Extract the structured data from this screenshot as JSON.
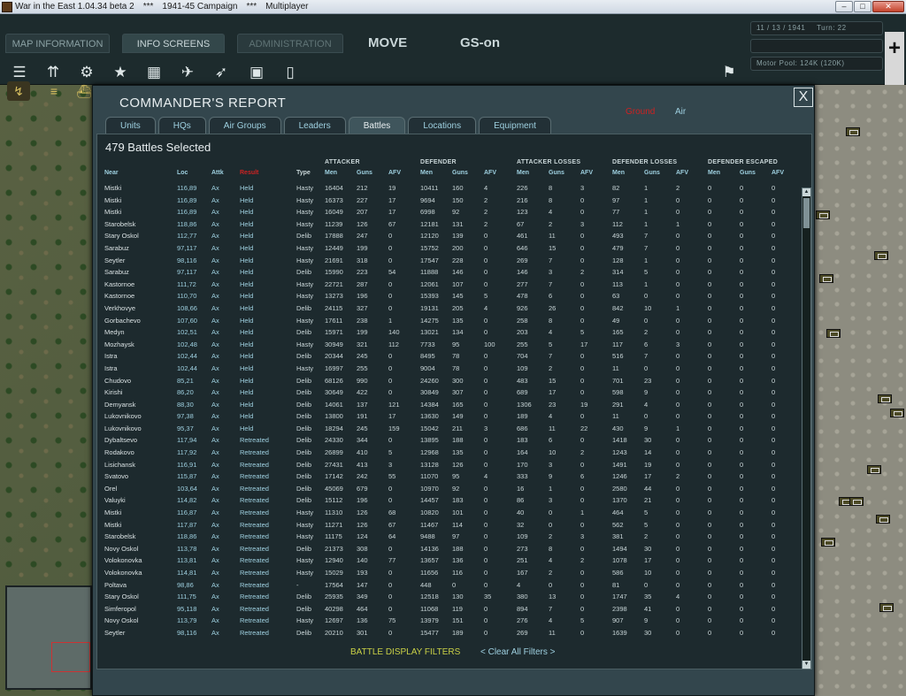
{
  "window": {
    "title": "War in the East 1.04.34 beta 2",
    "sep1": "***",
    "campaign": "1941-45 Campaign",
    "sep2": "***",
    "mode": "Multiplayer",
    "minimize": "–",
    "maximize": "□",
    "close": "✕"
  },
  "topbar": {
    "tabs": [
      "MAP INFORMATION",
      "INFO SCREENS",
      "ADMINISTRATION"
    ],
    "move": "MOVE",
    "gs": "GS-on",
    "date": "11 / 13 / 1941",
    "turn": "Turn: 22",
    "motor_pool": "Motor Pool:  124K (120K)",
    "tool_icons": [
      "stack-icon",
      "arrows-icon",
      "gear-icon",
      "star-icon",
      "factory-icon",
      "plane-icon",
      "rocket-icon",
      "clipboard-icon",
      "document-icon"
    ],
    "order_icons": [
      "path-icon",
      "rail-icon",
      "ship-icon"
    ]
  },
  "report": {
    "title": "COMMANDER'S REPORT",
    "close": "X",
    "filter_land": "Ground",
    "filter_air": "Air",
    "tabs": [
      "Units",
      "HQs",
      "Air Groups",
      "Leaders",
      "Battles",
      "Locations",
      "Equipment"
    ],
    "active_tab": "Battles",
    "count": "479 Battles Selected",
    "group_headers": {
      "attacker": "ATTACKER",
      "defender": "DEFENDER",
      "attacker_losses": "ATTACKER LOSSES",
      "defender_losses": "DEFENDER LOSSES",
      "defender_escaped": "DEFENDER ESCAPED"
    },
    "columns": {
      "near": "Near",
      "loc": "Loc",
      "attk": "Attk",
      "result": "Result",
      "type": "Type",
      "att_men": "Men",
      "att_guns": "Guns",
      "att_afv": "AFV",
      "def_men": "Men",
      "def_guns": "Guns",
      "def_afv": "AFV",
      "al_men": "Men",
      "al_guns": "Guns",
      "al_afv": "AFV",
      "dl_men": "Men",
      "dl_guns": "Guns",
      "dl_afv": "AFV",
      "de_men": "Men",
      "de_guns": "Guns",
      "de_afv": "AFV"
    },
    "rows": [
      [
        "Mistki",
        "116,89",
        "Ax",
        "Held",
        "Hasty",
        "16404",
        "212",
        "19",
        "10411",
        "160",
        "4",
        "226",
        "8",
        "3",
        "82",
        "1",
        "2",
        "0",
        "0",
        "0"
      ],
      [
        "Mistki",
        "116,89",
        "Ax",
        "Held",
        "Hasty",
        "16373",
        "227",
        "17",
        "9694",
        "150",
        "2",
        "216",
        "8",
        "0",
        "97",
        "1",
        "0",
        "0",
        "0",
        "0"
      ],
      [
        "Mistki",
        "116,89",
        "Ax",
        "Held",
        "Hasty",
        "16049",
        "207",
        "17",
        "6998",
        "92",
        "2",
        "123",
        "4",
        "0",
        "77",
        "1",
        "0",
        "0",
        "0",
        "0"
      ],
      [
        "Starobelsk",
        "118,86",
        "Ax",
        "Held",
        "Hasty",
        "11239",
        "126",
        "67",
        "12181",
        "131",
        "2",
        "67",
        "2",
        "3",
        "112",
        "1",
        "1",
        "0",
        "0",
        "0"
      ],
      [
        "Stary Oskol",
        "112,77",
        "Ax",
        "Held",
        "Delib",
        "17888",
        "247",
        "0",
        "12120",
        "139",
        "0",
        "461",
        "11",
        "0",
        "493",
        "7",
        "0",
        "0",
        "0",
        "0"
      ],
      [
        "Sarabuz",
        "97,117",
        "Ax",
        "Held",
        "Hasty",
        "12449",
        "199",
        "0",
        "15752",
        "200",
        "0",
        "646",
        "15",
        "0",
        "479",
        "7",
        "0",
        "0",
        "0",
        "0"
      ],
      [
        "Seytler",
        "98,116",
        "Ax",
        "Held",
        "Hasty",
        "21691",
        "318",
        "0",
        "17547",
        "228",
        "0",
        "269",
        "7",
        "0",
        "128",
        "1",
        "0",
        "0",
        "0",
        "0"
      ],
      [
        "Sarabuz",
        "97,117",
        "Ax",
        "Held",
        "Delib",
        "15990",
        "223",
        "54",
        "11888",
        "146",
        "0",
        "146",
        "3",
        "2",
        "314",
        "5",
        "0",
        "0",
        "0",
        "0"
      ],
      [
        "Kastornoe",
        "111,72",
        "Ax",
        "Held",
        "Hasty",
        "22721",
        "287",
        "0",
        "12061",
        "107",
        "0",
        "277",
        "7",
        "0",
        "113",
        "1",
        "0",
        "0",
        "0",
        "0"
      ],
      [
        "Kastornoe",
        "110,70",
        "Ax",
        "Held",
        "Hasty",
        "13273",
        "196",
        "0",
        "15393",
        "145",
        "5",
        "478",
        "6",
        "0",
        "63",
        "0",
        "0",
        "0",
        "0",
        "0"
      ],
      [
        "Verkhovye",
        "108,66",
        "Ax",
        "Held",
        "Delib",
        "24115",
        "327",
        "0",
        "19131",
        "205",
        "4",
        "926",
        "26",
        "0",
        "842",
        "10",
        "1",
        "0",
        "0",
        "0"
      ],
      [
        "Gorbachevo",
        "107,60",
        "Ax",
        "Held",
        "Hasty",
        "17611",
        "238",
        "1",
        "14275",
        "135",
        "0",
        "258",
        "8",
        "0",
        "49",
        "0",
        "0",
        "0",
        "0",
        "0"
      ],
      [
        "Medyn",
        "102,51",
        "Ax",
        "Held",
        "Delib",
        "15971",
        "199",
        "140",
        "13021",
        "134",
        "0",
        "203",
        "4",
        "5",
        "165",
        "2",
        "0",
        "0",
        "0",
        "0"
      ],
      [
        "Mozhaysk",
        "102,48",
        "Ax",
        "Held",
        "Hasty",
        "30949",
        "321",
        "112",
        "7733",
        "95",
        "100",
        "255",
        "5",
        "17",
        "117",
        "6",
        "3",
        "0",
        "0",
        "0"
      ],
      [
        "Istra",
        "102,44",
        "Ax",
        "Held",
        "Delib",
        "20344",
        "245",
        "0",
        "8495",
        "78",
        "0",
        "704",
        "7",
        "0",
        "516",
        "7",
        "0",
        "0",
        "0",
        "0"
      ],
      [
        "Istra",
        "102,44",
        "Ax",
        "Held",
        "Hasty",
        "16997",
        "255",
        "0",
        "9004",
        "78",
        "0",
        "109",
        "2",
        "0",
        "11",
        "0",
        "0",
        "0",
        "0",
        "0"
      ],
      [
        "Chudovo",
        "85,21",
        "Ax",
        "Held",
        "Delib",
        "68126",
        "990",
        "0",
        "24260",
        "300",
        "0",
        "483",
        "15",
        "0",
        "701",
        "23",
        "0",
        "0",
        "0",
        "0"
      ],
      [
        "Kirishi",
        "86,20",
        "Ax",
        "Held",
        "Delib",
        "30649",
        "422",
        "0",
        "30849",
        "307",
        "0",
        "689",
        "17",
        "0",
        "598",
        "9",
        "0",
        "0",
        "0",
        "0"
      ],
      [
        "Demyansk",
        "88,30",
        "Ax",
        "Held",
        "Delib",
        "14061",
        "137",
        "121",
        "14384",
        "165",
        "0",
        "1306",
        "23",
        "19",
        "291",
        "4",
        "0",
        "0",
        "0",
        "0"
      ],
      [
        "Lukovnikovo",
        "97,38",
        "Ax",
        "Held",
        "Delib",
        "13800",
        "191",
        "17",
        "13630",
        "149",
        "0",
        "189",
        "4",
        "0",
        "11",
        "0",
        "0",
        "0",
        "0",
        "0"
      ],
      [
        "Lukovnikovo",
        "95,37",
        "Ax",
        "Held",
        "Delib",
        "18294",
        "245",
        "159",
        "15042",
        "211",
        "3",
        "686",
        "11",
        "22",
        "430",
        "9",
        "1",
        "0",
        "0",
        "0"
      ],
      [
        "Dybaltsevo",
        "117,94",
        "Ax",
        "Retreated",
        "Delib",
        "24330",
        "344",
        "0",
        "13895",
        "188",
        "0",
        "183",
        "6",
        "0",
        "1418",
        "30",
        "0",
        "0",
        "0",
        "0"
      ],
      [
        "Rodakovo",
        "117,92",
        "Ax",
        "Retreated",
        "Delib",
        "26899",
        "410",
        "5",
        "12968",
        "135",
        "0",
        "164",
        "10",
        "2",
        "1243",
        "14",
        "0",
        "0",
        "0",
        "0"
      ],
      [
        "Lisichansk",
        "116,91",
        "Ax",
        "Retreated",
        "Delib",
        "27431",
        "413",
        "3",
        "13128",
        "126",
        "0",
        "170",
        "3",
        "0",
        "1491",
        "19",
        "0",
        "0",
        "0",
        "0"
      ],
      [
        "Svatovo",
        "115,87",
        "Ax",
        "Retreated",
        "Delib",
        "17142",
        "242",
        "55",
        "11070",
        "95",
        "4",
        "333",
        "9",
        "6",
        "1246",
        "17",
        "2",
        "0",
        "0",
        "0"
      ],
      [
        "Orel",
        "103,64",
        "Ax",
        "Retreated",
        "Delib",
        "45069",
        "679",
        "0",
        "10970",
        "92",
        "0",
        "16",
        "1",
        "0",
        "2580",
        "44",
        "0",
        "0",
        "0",
        "0"
      ],
      [
        "Valuyki",
        "114,82",
        "Ax",
        "Retreated",
        "Delib",
        "15112",
        "196",
        "0",
        "14457",
        "183",
        "0",
        "86",
        "3",
        "0",
        "1370",
        "21",
        "0",
        "0",
        "0",
        "0"
      ],
      [
        "Mistki",
        "116,87",
        "Ax",
        "Retreated",
        "Hasty",
        "11310",
        "126",
        "68",
        "10820",
        "101",
        "0",
        "40",
        "0",
        "1",
        "464",
        "5",
        "0",
        "0",
        "0",
        "0"
      ],
      [
        "Mistki",
        "117,87",
        "Ax",
        "Retreated",
        "Hasty",
        "11271",
        "126",
        "67",
        "11467",
        "114",
        "0",
        "32",
        "0",
        "0",
        "562",
        "5",
        "0",
        "0",
        "0",
        "0"
      ],
      [
        "Starobelsk",
        "118,86",
        "Ax",
        "Retreated",
        "Hasty",
        "11175",
        "124",
        "64",
        "9488",
        "97",
        "0",
        "109",
        "2",
        "3",
        "381",
        "2",
        "0",
        "0",
        "0",
        "0"
      ],
      [
        "Novy Oskol",
        "113,78",
        "Ax",
        "Retreated",
        "Delib",
        "21373",
        "308",
        "0",
        "14136",
        "188",
        "0",
        "273",
        "8",
        "0",
        "1494",
        "30",
        "0",
        "0",
        "0",
        "0"
      ],
      [
        "Volokonovka",
        "113,81",
        "Ax",
        "Retreated",
        "Hasty",
        "12940",
        "140",
        "77",
        "13657",
        "136",
        "0",
        "251",
        "4",
        "2",
        "1078",
        "17",
        "0",
        "0",
        "0",
        "0"
      ],
      [
        "Volokonovka",
        "114,81",
        "Ax",
        "Retreated",
        "Hasty",
        "15029",
        "193",
        "0",
        "11656",
        "116",
        "0",
        "167",
        "2",
        "0",
        "586",
        "10",
        "0",
        "0",
        "0",
        "0"
      ],
      [
        "Poltava",
        "98,86",
        "Ax",
        "Retreated",
        "-",
        "17564",
        "147",
        "0",
        "448",
        "0",
        "0",
        "4",
        "0",
        "0",
        "81",
        "0",
        "0",
        "0",
        "0",
        "0"
      ],
      [
        "Stary Oskol",
        "111,75",
        "Ax",
        "Retreated",
        "Delib",
        "25935",
        "349",
        "0",
        "12518",
        "130",
        "35",
        "380",
        "13",
        "0",
        "1747",
        "35",
        "4",
        "0",
        "0",
        "0"
      ],
      [
        "Simferopol",
        "95,118",
        "Ax",
        "Retreated",
        "Delib",
        "40298",
        "464",
        "0",
        "11068",
        "119",
        "0",
        "894",
        "7",
        "0",
        "2398",
        "41",
        "0",
        "0",
        "0",
        "0"
      ],
      [
        "Novy Oskol",
        "113,79",
        "Ax",
        "Retreated",
        "Hasty",
        "12697",
        "136",
        "75",
        "13979",
        "151",
        "0",
        "276",
        "4",
        "5",
        "907",
        "9",
        "0",
        "0",
        "0",
        "0"
      ],
      [
        "Seytler",
        "98,116",
        "Ax",
        "Retreated",
        "Delib",
        "20210",
        "301",
        "0",
        "15477",
        "189",
        "0",
        "269",
        "11",
        "0",
        "1639",
        "30",
        "0",
        "0",
        "0",
        "0"
      ]
    ],
    "footer_filters": "BATTLE DISPLAY FILTERS",
    "footer_clear": "< Clear All Filters >"
  }
}
